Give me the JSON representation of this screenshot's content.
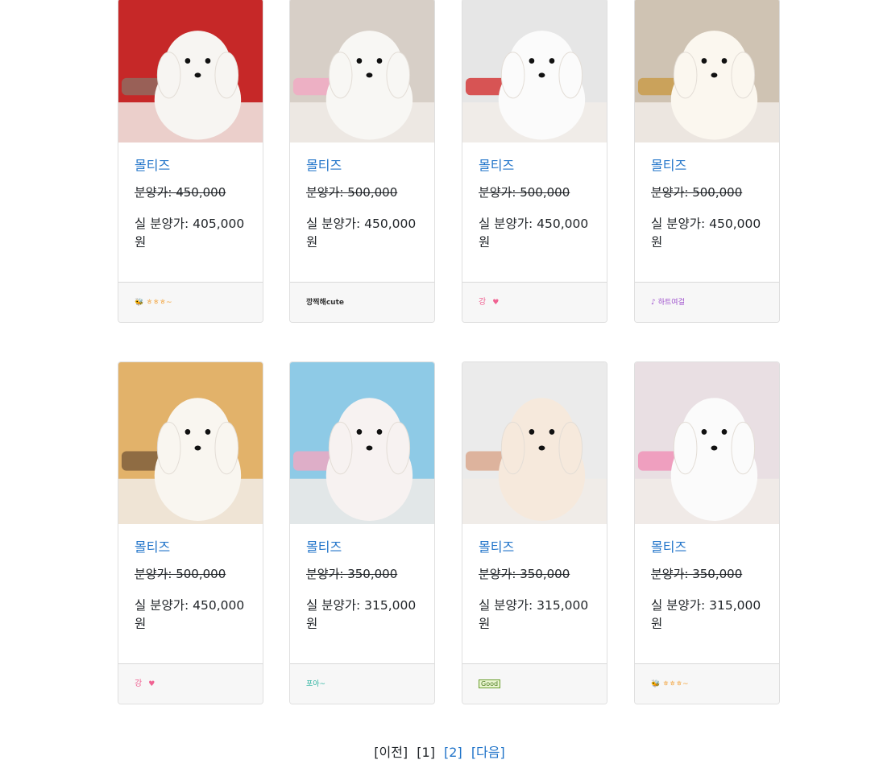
{
  "cards": [
    {
      "title": "몰티즈",
      "old_price": "분양가: 450,000",
      "real_price": "실 분양가: 405,000 원",
      "nickname_icon": "bee-sticker-icon",
      "nickname": "ㅎㅎㅎ~",
      "palette": {
        "bg": "#c62828",
        "dog": "#f7f5f2",
        "accent": "#8d6e63"
      }
    },
    {
      "title": "몰티즈",
      "old_price": "분양가: 500,000",
      "real_price": "실 분양가: 450,000 원",
      "nickname_icon": "",
      "nickname": "깡찍해cute",
      "palette": {
        "bg": "#d7cfc7",
        "dog": "#f8f7f4",
        "accent": "#f2a7c3"
      }
    },
    {
      "title": "몰티즈",
      "old_price": "분양가: 500,000",
      "real_price": "실 분양가: 450,000 원",
      "nickname_icon": "heart-sticker-icon",
      "nickname": "강",
      "palette": {
        "bg": "#e6e6e6",
        "dog": "#fbfbfb",
        "accent": "#d32f2f"
      }
    },
    {
      "title": "몰티즈",
      "old_price": "분양가: 500,000",
      "real_price": "실 분양가: 450,000 원",
      "nickname_icon": "music-note-icon",
      "nickname": "하트여걸",
      "palette": {
        "bg": "#cfc3b3",
        "dog": "#fbf7ef",
        "accent": "#c89a45"
      }
    },
    {
      "title": "몰티즈",
      "old_price": "분양가: 500,000",
      "real_price": "실 분양가: 450,000 원",
      "nickname_icon": "heart-sticker-icon",
      "nickname": "강",
      "palette": {
        "bg": "#e2b26a",
        "dog": "#f9f6f0",
        "accent": "#7a5a3a"
      }
    },
    {
      "title": "몰티즈",
      "old_price": "분양가: 350,000",
      "real_price": "실 분양가: 315,000 원",
      "nickname_icon": "",
      "nickname": "포아~",
      "palette": {
        "bg": "#8ecae6",
        "dog": "#f7f2f1",
        "accent": "#f3a6c0"
      }
    },
    {
      "title": "몰티즈",
      "old_price": "분양가: 350,000",
      "real_price": "실 분양가: 315,000 원",
      "nickname_icon": "good-badge-icon",
      "nickname": "Good",
      "palette": {
        "bg": "#ebebeb",
        "dog": "#f6e9dc",
        "accent": "#d9a58a"
      }
    },
    {
      "title": "몰티즈",
      "old_price": "분양가: 350,000",
      "real_price": "실 분양가: 315,000 원",
      "nickname_icon": "bee-sticker-icon",
      "nickname": "ㅎㅎㅎ~",
      "palette": {
        "bg": "#e9dfe3",
        "dog": "#fbfbfb",
        "accent": "#f08fb5"
      }
    }
  ],
  "pagination": {
    "prev": "[이전]",
    "current": "[1]",
    "page2": "[2]",
    "next": "[다음]"
  },
  "colors": {
    "link": "#1f73c9",
    "text": "#212529",
    "footer_bg": "#f7f7f7"
  }
}
